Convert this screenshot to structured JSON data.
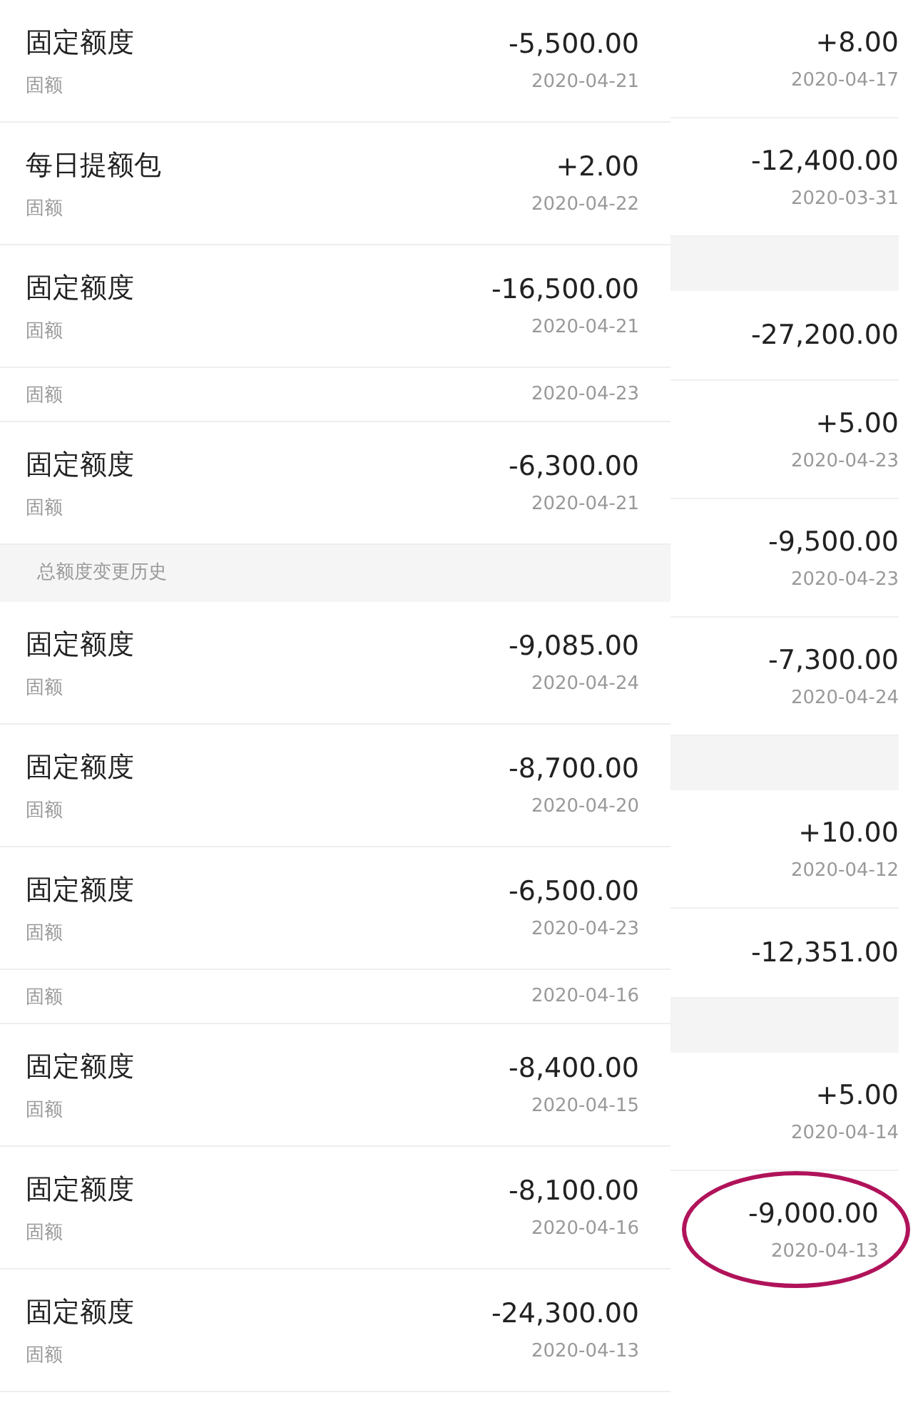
{
  "left": [
    {
      "kind": "entry",
      "title": "固定额度",
      "subtitle": "固额",
      "amount": "-5,500.00",
      "date": "2020-04-21"
    },
    {
      "kind": "entry",
      "title": "每日提额包",
      "subtitle": "固额",
      "amount": "+2.00",
      "date": "2020-04-22"
    },
    {
      "kind": "entry",
      "title": "固定额度",
      "subtitle": "固额",
      "amount": "-16,500.00",
      "date": "2020-04-21"
    },
    {
      "kind": "fragment",
      "subtitle": "固额",
      "date": "2020-04-23"
    },
    {
      "kind": "entry",
      "title": "固定额度",
      "subtitle": "固额",
      "amount": "-6,300.00",
      "date": "2020-04-21"
    },
    {
      "kind": "header",
      "title": "总额度变更历史"
    },
    {
      "kind": "entry",
      "title": "固定额度",
      "subtitle": "固额",
      "amount": "-9,085.00",
      "date": "2020-04-24"
    },
    {
      "kind": "entry",
      "title": "固定额度",
      "subtitle": "固额",
      "amount": "-8,700.00",
      "date": "2020-04-20"
    },
    {
      "kind": "entry",
      "title": "固定额度",
      "subtitle": "固额",
      "amount": "-6,500.00",
      "date": "2020-04-23"
    },
    {
      "kind": "fragment",
      "subtitle": "固额",
      "date": "2020-04-16"
    },
    {
      "kind": "entry",
      "title": "固定额度",
      "subtitle": "固额",
      "amount": "-8,400.00",
      "date": "2020-04-15"
    },
    {
      "kind": "entry",
      "title": "固定额度",
      "subtitle": "固额",
      "amount": "-8,100.00",
      "date": "2020-04-16"
    },
    {
      "kind": "entry",
      "title": "固定额度",
      "subtitle": "固额",
      "amount": "-24,300.00",
      "date": "2020-04-13"
    }
  ],
  "right": [
    {
      "kind": "entry",
      "amount": "+8.00",
      "date": "2020-04-17",
      "circled": false
    },
    {
      "kind": "entry",
      "amount": "-12,400.00",
      "date": "2020-03-31",
      "circled": false
    },
    {
      "kind": "blank"
    },
    {
      "kind": "entry",
      "amount": "-27,200.00",
      "circled": false
    },
    {
      "kind": "entry",
      "amount": "+5.00",
      "date": "2020-04-23",
      "circled": false
    },
    {
      "kind": "entry",
      "amount": "-9,500.00",
      "date": "2020-04-23",
      "circled": false
    },
    {
      "kind": "entry",
      "amount": "-7,300.00",
      "date": "2020-04-24",
      "circled": false
    },
    {
      "kind": "blank"
    },
    {
      "kind": "entry",
      "amount": "+10.00",
      "date": "2020-04-12",
      "circled": false
    },
    {
      "kind": "entry",
      "amount": "-12,351.00",
      "circled": false
    },
    {
      "kind": "blank"
    },
    {
      "kind": "entry",
      "amount": "+5.00",
      "date": "2020-04-14",
      "circled": false
    },
    {
      "kind": "entry",
      "amount": "-9,000.00",
      "date": "2020-04-13",
      "circled": true
    }
  ]
}
